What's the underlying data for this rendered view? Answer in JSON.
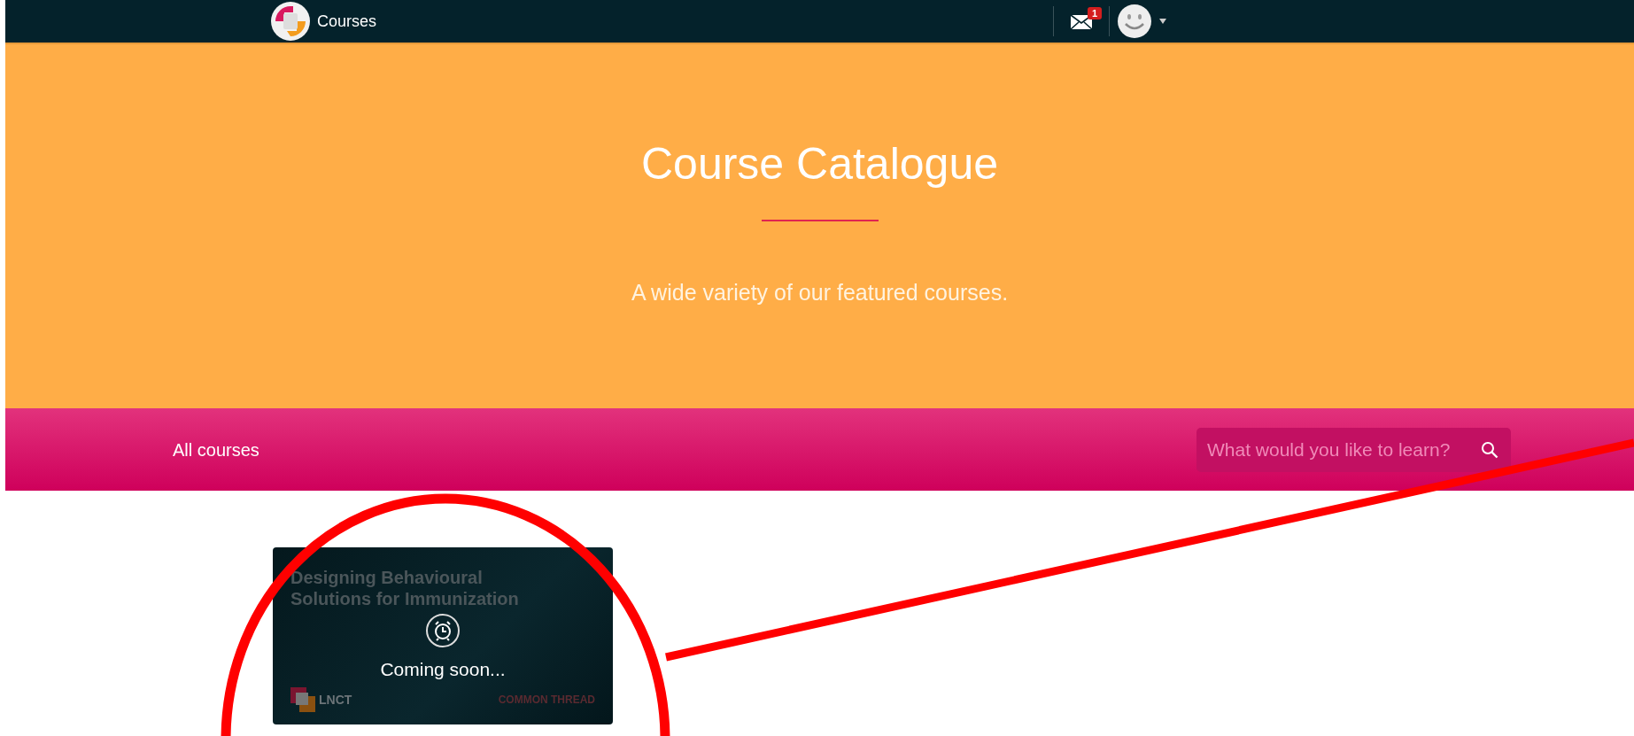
{
  "navbar": {
    "title": "Courses",
    "notification_count": "1"
  },
  "hero": {
    "title": "Course Catalogue",
    "subtitle": "A wide variety of our featured courses."
  },
  "filter_bar": {
    "label": "All courses",
    "search": {
      "placeholder": "What would you like to learn?"
    }
  },
  "courses": [
    {
      "title": "Designing Behavioural Solutions for Immunization",
      "status": "Coming soon...",
      "logo_text": "LNCT",
      "partner": "COMMON THREAD"
    }
  ]
}
